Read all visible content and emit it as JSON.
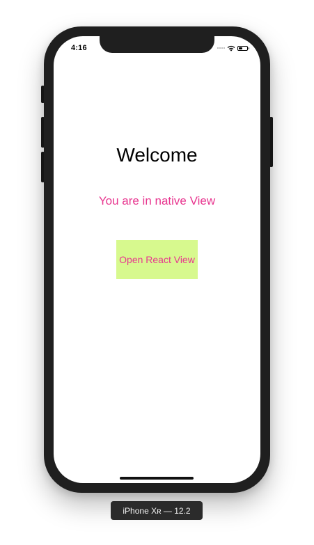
{
  "status_bar": {
    "time": "4:16",
    "battery_level": 0.45
  },
  "content": {
    "title": "Welcome",
    "subtitle": "You are in native View",
    "open_button_label": "Open React View"
  },
  "device_label": "iPhone Xʀ — 12.2",
  "colors": {
    "accent_text": "#e8368f",
    "button_bg": "#d7f98e",
    "frame": "#1f1f1f"
  },
  "icons": [
    "wifi-icon",
    "battery-icon",
    "signal-icon"
  ]
}
